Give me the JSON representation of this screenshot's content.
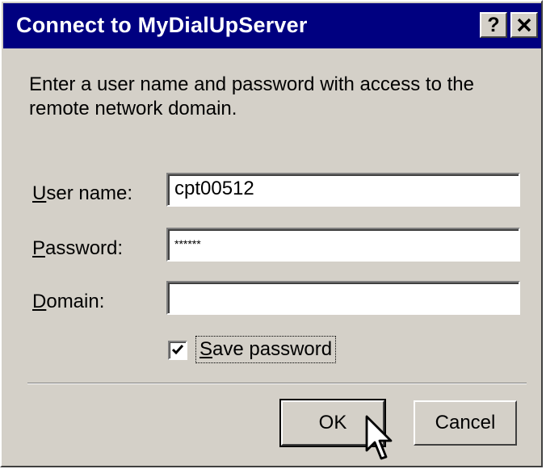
{
  "window": {
    "title": "Connect to MyDialUpServer",
    "help_glyph": "?",
    "close_glyph": "✕"
  },
  "prompt": "Enter a user name and password with access to the remote network domain.",
  "fields": {
    "username": {
      "label_accel": "U",
      "label_rest": "ser name:",
      "value": "cpt00512"
    },
    "password": {
      "label_accel": "P",
      "label_rest": "assword:",
      "value": "******"
    },
    "domain": {
      "label_accel": "D",
      "label_rest": "omain:",
      "value": ""
    }
  },
  "save_password": {
    "checked": true,
    "label_accel": "S",
    "label_rest": "ave password"
  },
  "buttons": {
    "ok": "OK",
    "cancel": "Cancel"
  },
  "icons": [
    "help-icon",
    "close-icon",
    "checkmark-icon",
    "mouse-pointer-icon"
  ]
}
